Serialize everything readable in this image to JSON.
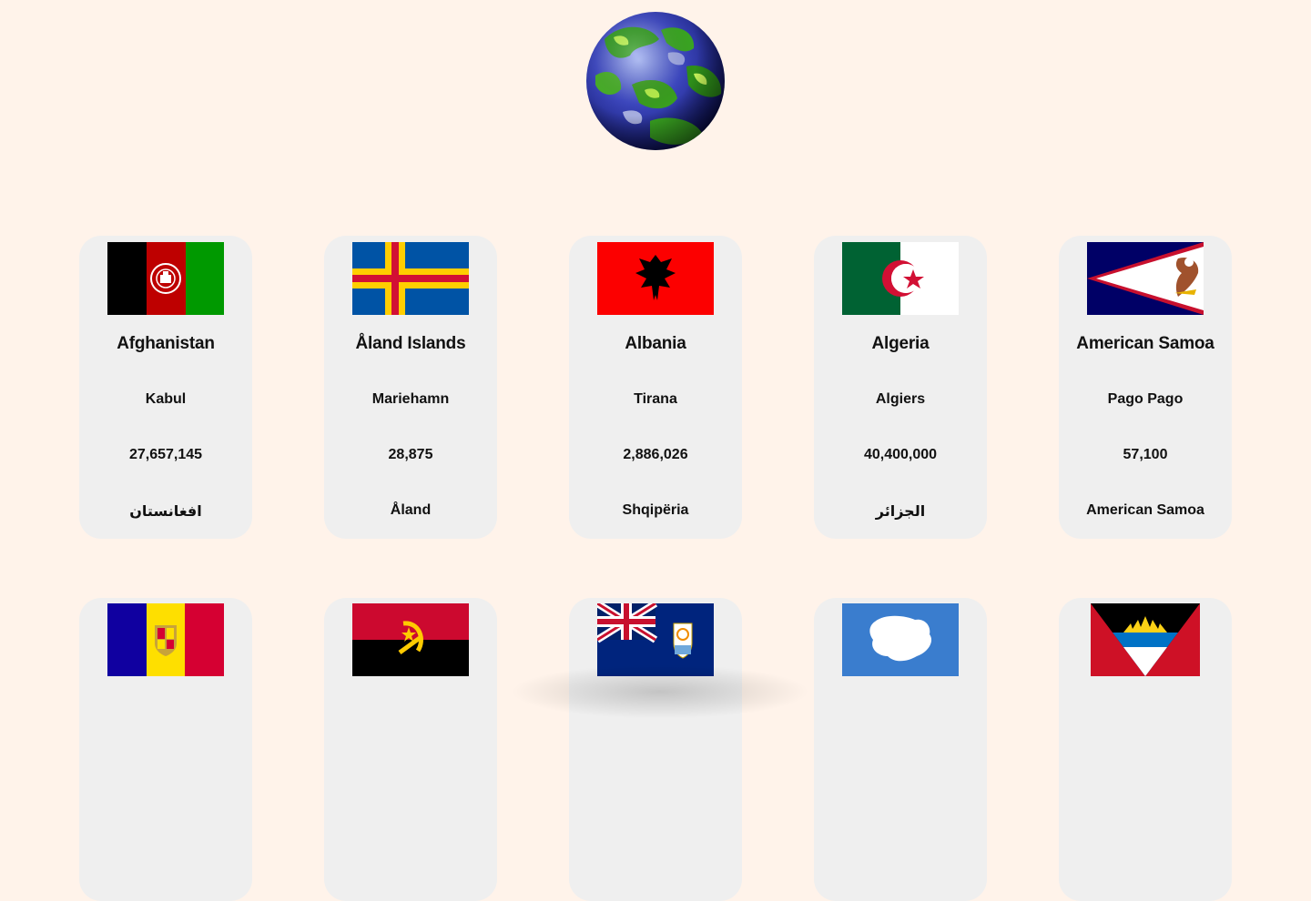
{
  "header": {
    "logo_icon": "globe-icon"
  },
  "countries": [
    {
      "name": "Afghanistan",
      "capital": "Kabul",
      "population": "27,657,145",
      "native_name": "افغانستان",
      "flag": "afghanistan-flag"
    },
    {
      "name": "Åland Islands",
      "capital": "Mariehamn",
      "population": "28,875",
      "native_name": "Åland",
      "flag": "aland-islands-flag"
    },
    {
      "name": "Albania",
      "capital": "Tirana",
      "population": "2,886,026",
      "native_name": "Shqipëria",
      "flag": "albania-flag"
    },
    {
      "name": "Algeria",
      "capital": "Algiers",
      "population": "40,400,000",
      "native_name": "الجزائر",
      "flag": "algeria-flag"
    },
    {
      "name": "American Samoa",
      "capital": "Pago Pago",
      "population": "57,100",
      "native_name": "American Samoa",
      "flag": "american-samoa-flag"
    },
    {
      "flag": "andorra-flag"
    },
    {
      "flag": "angola-flag"
    },
    {
      "flag": "anguilla-flag"
    },
    {
      "flag": "antarctica-flag"
    },
    {
      "flag": "antigua-and-barbuda-flag"
    }
  ],
  "colors": {
    "background": "#fff3ea",
    "card": "#efefef"
  }
}
